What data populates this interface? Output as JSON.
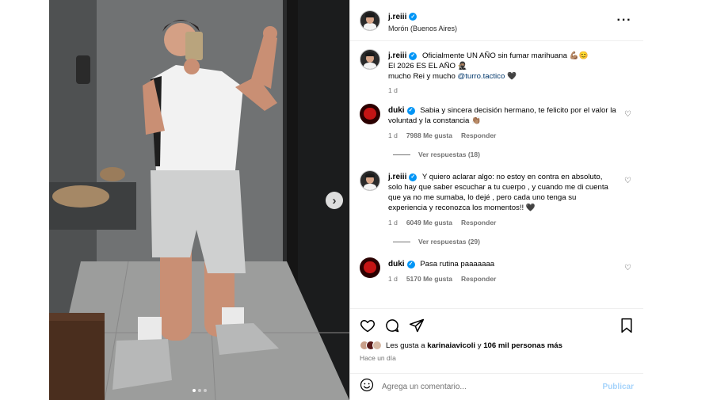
{
  "post": {
    "author": "j.reiii",
    "location": "Morón (Buenos Aires)",
    "caption": {
      "line1": "Oficialmente UN AÑO sin fumar marihuana 💪🏽😊",
      "line2": "El 2026 ES EL AÑO 🥷🏽",
      "line3_prefix": "mucho Rei y mucho ",
      "mention": "@turro.tactico",
      "line3_suffix": " 🖤",
      "time": "1 d"
    }
  },
  "comments": [
    {
      "user": "duki",
      "text": "Sabia y sincera decisión hermano, te felicito por el valor la voluntad y la constancia 👏🏽",
      "time": "1 d",
      "likes": "7988 Me gusta",
      "reply": "Responder",
      "view_replies": "Ver respuestas (18)"
    },
    {
      "user": "j.reiii",
      "text": "Y quiero aclarar algo: no estoy en contra en absoluto, solo hay que saber escuchar a tu cuerpo , y cuando me di cuenta que ya no me sumaba, lo dejé , pero cada uno tenga su experiencia y reconozca los momentos!! 🖤",
      "time": "1 d",
      "likes": "6049 Me gusta",
      "reply": "Responder",
      "view_replies": "Ver respuestas (29)"
    },
    {
      "user": "duki",
      "text": "Pasa rutina paaaaaaa",
      "time": "1 d",
      "likes": "5170 Me gusta",
      "reply": "Responder"
    }
  ],
  "likes": {
    "prefix": "Les gusta a ",
    "user": "karinaiavicoli",
    "middle": " y ",
    "count": "106 mil personas más"
  },
  "posted_time": "Hace un día",
  "add_comment": {
    "placeholder": "Agrega un comentario...",
    "publish": "Publicar"
  },
  "icons": {
    "more": "more-options-icon",
    "like": "heart-icon",
    "comment": "comment-icon",
    "share": "share-icon",
    "save": "bookmark-icon",
    "emoji": "emoji-icon",
    "next": "chevron-right-icon"
  },
  "colors": {
    "verified": "#0095f6",
    "mention": "#00376b",
    "muted": "#737373",
    "publish": "#a5d3fb"
  },
  "carousel": {
    "slides": 3,
    "active": 1
  }
}
